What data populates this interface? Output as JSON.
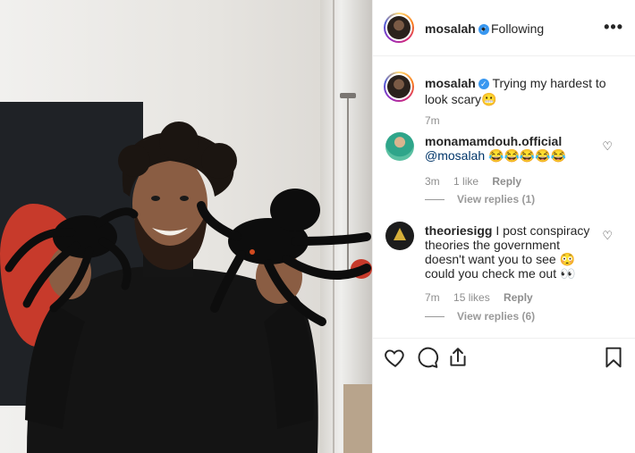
{
  "post": {
    "username": "mosalah",
    "follow_state": "Following",
    "separator": "•",
    "more_icon": "more-options-icon",
    "verified_icon": "verified-badge-icon"
  },
  "caption": {
    "username": "mosalah",
    "text": "Trying my hardest to look scary",
    "emoji": "😬",
    "time": "7m"
  },
  "comments": [
    {
      "username": "monamamdouh.official",
      "mention": "@mosalah",
      "text": "😂😂😂😂😂",
      "time": "3m",
      "likes": "1 like",
      "reply_label": "Reply",
      "view_replies": "View replies (1)"
    },
    {
      "username": "theoriesigg",
      "text": "I post conspiracy theories the government doesn't want you to see 😳 could you check me out 👀",
      "time": "7m",
      "likes": "15 likes",
      "reply_label": "Reply",
      "view_replies": "View replies (6)"
    }
  ],
  "actions": {
    "like_icon": "heart-icon",
    "comment_icon": "comment-icon",
    "share_icon": "share-icon",
    "save_icon": "bookmark-icon"
  },
  "colors": {
    "verified_blue": "#3897f0",
    "text": "#262626",
    "muted": "#8e8e8e",
    "mention": "#003569"
  }
}
